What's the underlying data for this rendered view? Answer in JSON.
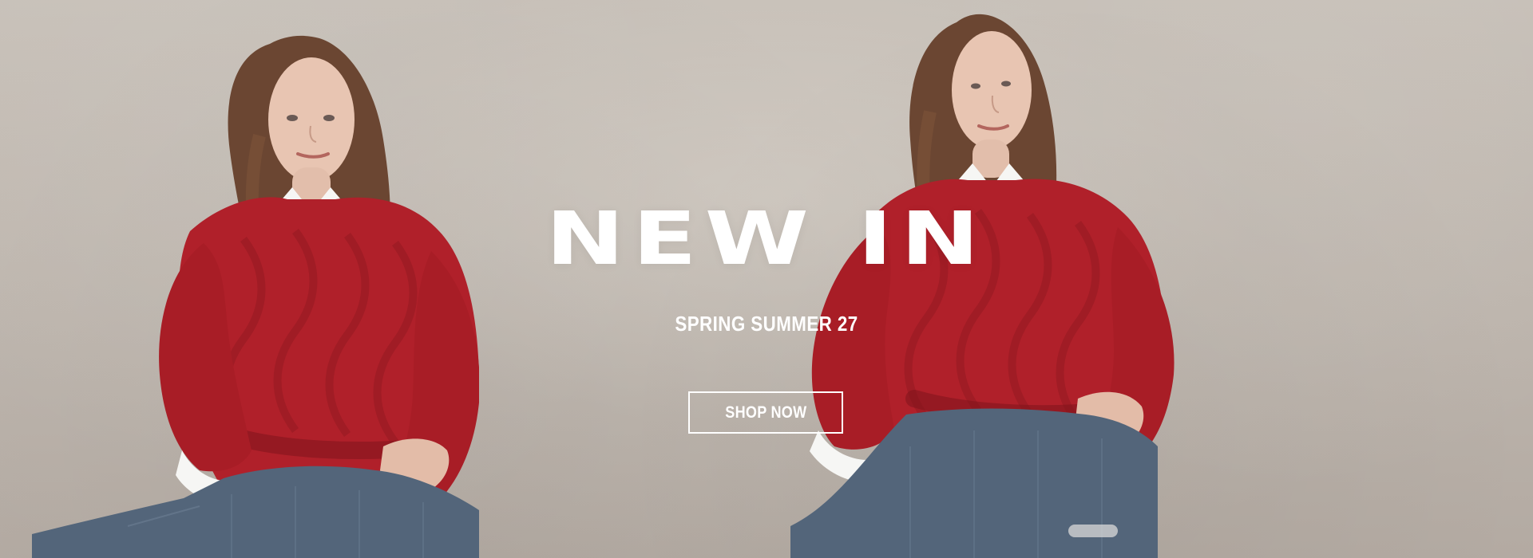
{
  "hero": {
    "headline": "NEW IN",
    "subheadline": "SPRING SUMMER 27",
    "cta_label": "SHOP NOW",
    "colors": {
      "text": "#ffffff",
      "background_wall": "#bdb5ad",
      "sweater_red": "#b0202a",
      "denim_blue": "#53657a",
      "shirt_white": "#f3f3f1"
    }
  }
}
